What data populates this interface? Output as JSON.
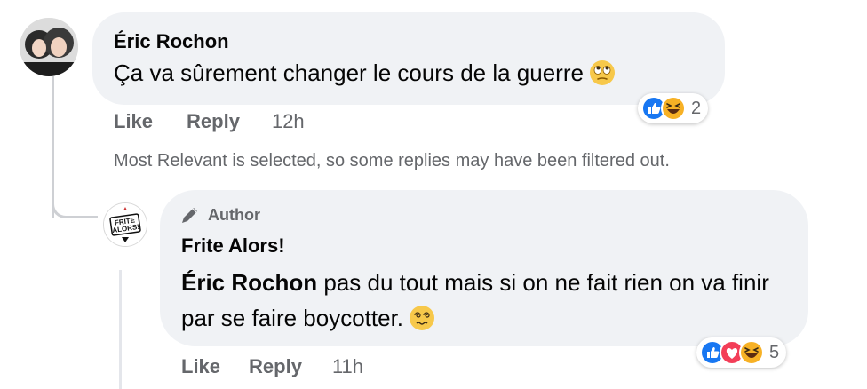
{
  "comment1": {
    "author": "Éric Rochon",
    "text": "Ça va sûrement changer le cours de la guerre",
    "emoji": "face-with-rolling-eyes",
    "reactions": {
      "icons": [
        "like",
        "laugh"
      ],
      "count": "2"
    },
    "actions": {
      "like": "Like",
      "reply": "Reply",
      "time": "12h"
    }
  },
  "filter_notice": "Most Relevant is selected, so some replies may have been filtered out.",
  "reply1": {
    "badge": "Author",
    "author": "Frite Alors!",
    "avatar_text": "FRITE ALORS!",
    "mention": "Éric Rochon",
    "text": " pas du tout mais si on ne fait rien on va finir par se faire boycotter.",
    "emoji": "woozy-face",
    "reactions": {
      "icons": [
        "like",
        "love",
        "laugh"
      ],
      "count": "5"
    },
    "actions": {
      "like": "Like",
      "reply": "Reply",
      "time": "11h"
    }
  },
  "colors": {
    "bubble": "#f0f2f5",
    "secondary_text": "#65676b",
    "like_blue": "#1877f2",
    "love_red": "#f33e58",
    "emoji_yellow": "#f7b125"
  }
}
